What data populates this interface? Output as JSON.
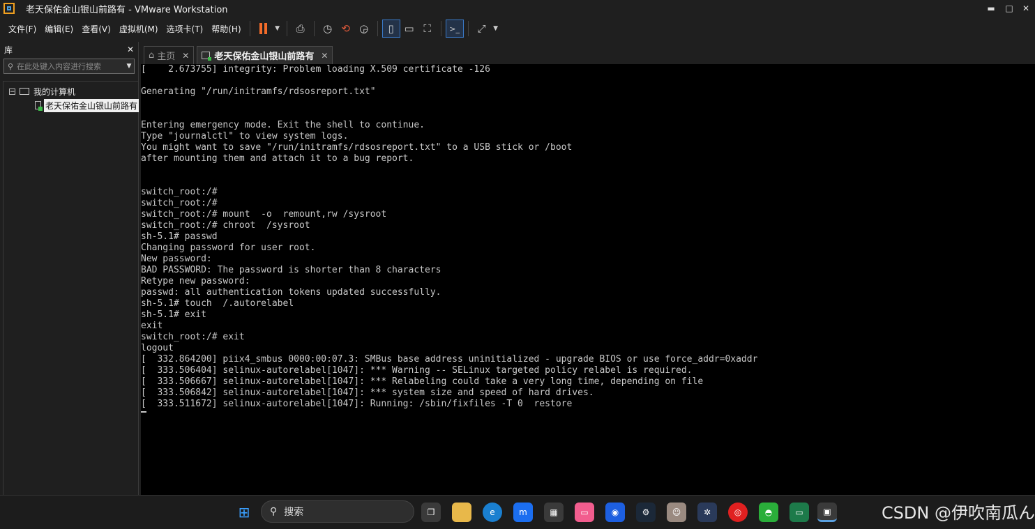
{
  "window": {
    "title": "老天保佑金山银山前路有 - VMware Workstation",
    "controls": {
      "minimize": "▬",
      "maximize": "□",
      "close": "✕"
    }
  },
  "menu": [
    "文件(F)",
    "编辑(E)",
    "查看(V)",
    "虚拟机(M)",
    "选项卡(T)",
    "帮助(H)"
  ],
  "toolbar": {
    "icons": [
      "pause-icon",
      "send-ctrl-alt-del-icon",
      "snapshot-icon",
      "revert-snapshot-icon",
      "snapshot-manager-icon",
      "sidebar-view-icon",
      "thumbnail-bar-icon",
      "fullscreen-icon",
      "console-view-icon",
      "stretch-guest-icon"
    ],
    "accent_pause": "#f36c2a"
  },
  "library": {
    "title": "库",
    "close": "✕",
    "search_placeholder": "在此处键入内容进行搜索",
    "tree": {
      "root": "我的计算机",
      "expander": "−",
      "vm": "老天保佑金山银山前路有"
    }
  },
  "tabs": [
    {
      "label": "主页",
      "close": "✕"
    },
    {
      "label": "老天保佑金山银山前路有",
      "close": "✕"
    }
  ],
  "console": {
    "lines": [
      "[    2.673755] integrity: Problem loading X.509 certificate -126",
      "",
      "Generating \"/run/initramfs/rdsosreport.txt\"",
      "",
      "",
      "Entering emergency mode. Exit the shell to continue.",
      "Type \"journalctl\" to view system logs.",
      "You might want to save \"/run/initramfs/rdsosreport.txt\" to a USB stick or /boot",
      "after mounting them and attach it to a bug report.",
      "",
      "",
      "switch_root:/#",
      "switch_root:/#",
      "switch_root:/# mount  -o  remount,rw /sysroot",
      "switch_root:/# chroot  /sysroot",
      "sh-5.1# passwd",
      "Changing password for user root.",
      "New password:",
      "BAD PASSWORD: The password is shorter than 8 characters",
      "Retype new password:",
      "passwd: all authentication tokens updated successfully.",
      "sh-5.1# touch  /.autorelabel",
      "sh-5.1# exit",
      "exit",
      "switch_root:/# exit",
      "logout",
      "[  332.864200] piix4_smbus 0000:00:07.3: SMBus base address uninitialized - upgrade BIOS or use force_addr=0xaddr",
      "[  333.506404] selinux-autorelabel[1047]: *** Warning -- SELinux targeted policy relabel is required.",
      "[  333.506667] selinux-autorelabel[1047]: *** Relabeling could take a very long time, depending on file",
      "[  333.506842] selinux-autorelabel[1047]: *** system size and speed of hard drives.",
      "[  333.511672] selinux-autorelabel[1047]: Running: /sbin/fixfiles -T 0  restore"
    ]
  },
  "taskbar": {
    "search_label": "搜索",
    "apps": [
      "windows-start-icon",
      "task-view-icon",
      "file-explorer-icon",
      "edge-icon",
      "app-m-icon",
      "microsoft-store-icon",
      "bilibili-icon",
      "app-blue-icon",
      "steam-icon",
      "avatar-app-icon",
      "settings-app-icon",
      "netease-music-icon",
      "wechat-icon",
      "app-green-icon",
      "vmware-icon"
    ]
  },
  "watermark": "CSDN @伊吹南瓜ん"
}
